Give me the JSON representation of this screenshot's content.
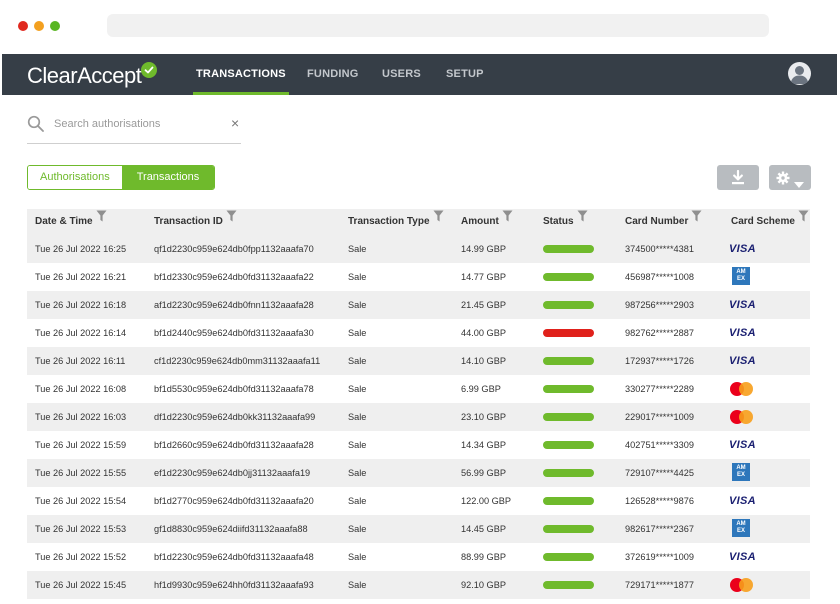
{
  "app": {
    "logo": "ClearAccept",
    "nav": [
      {
        "label": "TRANSACTIONS",
        "active": true
      },
      {
        "label": "FUNDING",
        "active": false
      },
      {
        "label": "USERS",
        "active": false
      },
      {
        "label": "SETUP",
        "active": false
      }
    ]
  },
  "search": {
    "placeholder": "Search authorisations",
    "value": "",
    "clear_glyph": "×"
  },
  "toggle": {
    "options": [
      "Authorisations",
      "Transactions"
    ],
    "selected": "Transactions"
  },
  "toolbar": {
    "download_icon": "download-icon",
    "settings_icon": "gear-icon"
  },
  "colors": {
    "brand_green": "#6fba2c",
    "status_ok": "#6fba2c",
    "status_failed": "#e0211b",
    "header_bg": "#363e47"
  },
  "table": {
    "columns": [
      "Date & Time",
      "Transaction ID",
      "Transaction Type",
      "Amount",
      "Status",
      "Card Number",
      "Card Scheme"
    ],
    "rows": [
      {
        "datetime": "Tue 26 Jul 2022 16:25",
        "id": "qf1d2230c959e624db0fpp1132aaafa70",
        "type": "Sale",
        "amount": "14.99 GBP",
        "status": "ok",
        "card": "374500*****4381",
        "scheme": "VISA"
      },
      {
        "datetime": "Tue 26 Jul 2022 16:21",
        "id": "bf1d2330c959e624db0fd31132aaafa22",
        "type": "Sale",
        "amount": "14.77 GBP",
        "status": "ok",
        "card": "456987*****1008",
        "scheme": "AMEX"
      },
      {
        "datetime": "Tue 26 Jul 2022 16:18",
        "id": "af1d2230c959e624db0fnn1132aaafa28",
        "type": "Sale",
        "amount": "21.45 GBP",
        "status": "ok",
        "card": "987256*****2903",
        "scheme": "VISA"
      },
      {
        "datetime": "Tue 26 Jul 2022 16:14",
        "id": "bf1d2440c959e624db0fd31132aaafa30",
        "type": "Sale",
        "amount": "44.00 GBP",
        "status": "failed",
        "card": "982762*****2887",
        "scheme": "VISA"
      },
      {
        "datetime": "Tue 26 Jul 2022 16:11",
        "id": "cf1d2230c959e624db0mm31132aaafa11",
        "type": "Sale",
        "amount": "14.10 GBP",
        "status": "ok",
        "card": "172937*****1726",
        "scheme": "VISA"
      },
      {
        "datetime": "Tue 26 Jul 2022 16:08",
        "id": "bf1d5530c959e624db0fd31132aaafa78",
        "type": "Sale",
        "amount": "6.99 GBP",
        "status": "ok",
        "card": "330277*****2289",
        "scheme": "MASTERCARD"
      },
      {
        "datetime": "Tue 26 Jul 2022 16:03",
        "id": "df1d2230c959e624db0kk31132aaafa99",
        "type": "Sale",
        "amount": "23.10 GBP",
        "status": "ok",
        "card": "229017*****1009",
        "scheme": "MASTERCARD"
      },
      {
        "datetime": "Tue 26 Jul 2022 15:59",
        "id": "bf1d2660c959e624db0fd31132aaafa28",
        "type": "Sale",
        "amount": "14.34 GBP",
        "status": "ok",
        "card": "402751*****3309",
        "scheme": "VISA"
      },
      {
        "datetime": "Tue 26 Jul 2022 15:55",
        "id": "ef1d2230c959e624db0jj31132aaafa19",
        "type": "Sale",
        "amount": "56.99 GBP",
        "status": "ok",
        "card": "729107*****4425",
        "scheme": "AMEX"
      },
      {
        "datetime": "Tue 26 Jul 2022 15:54",
        "id": "bf1d2770c959e624db0fd31132aaafa20",
        "type": "Sale",
        "amount": "122.00 GBP",
        "status": "ok",
        "card": "126528*****9876",
        "scheme": "VISA"
      },
      {
        "datetime": "Tue 26 Jul 2022 15:53",
        "id": "gf1d8830c959e624diifd31132aaafa88",
        "type": "Sale",
        "amount": "14.45 GBP",
        "status": "ok",
        "card": "982617*****2367",
        "scheme": "AMEX"
      },
      {
        "datetime": "Tue 26 Jul 2022 15:52",
        "id": "bf1d2230c959e624db0fd31132aaafa48",
        "type": "Sale",
        "amount": "88.99 GBP",
        "status": "ok",
        "card": "372619*****1009",
        "scheme": "VISA"
      },
      {
        "datetime": "Tue 26 Jul 2022 15:45",
        "id": "hf1d9930c959e624hh0fd31132aaafa93",
        "type": "Sale",
        "amount": "92.10 GBP",
        "status": "ok",
        "card": "729171*****1877",
        "scheme": "MASTERCARD"
      }
    ]
  }
}
